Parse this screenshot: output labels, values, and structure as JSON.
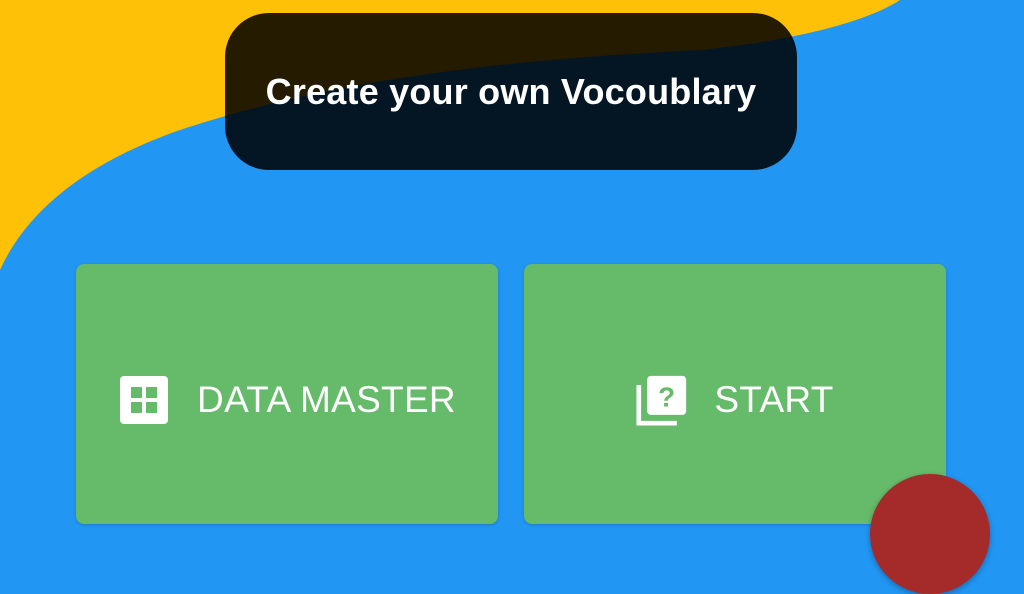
{
  "colors": {
    "background": "#2196F3",
    "accent_shape": "#FFC107",
    "card": "#66BB6A",
    "banner": "#000000",
    "fab": "#A52A2A",
    "text": "#FFFFFF"
  },
  "header": {
    "title": "Create your own Vocoublary"
  },
  "actions": [
    {
      "label": "DATA MASTER",
      "icon": "grid-icon"
    },
    {
      "label": "START",
      "icon": "question-library-icon"
    }
  ],
  "fab": {
    "icon": "fab-icon"
  }
}
